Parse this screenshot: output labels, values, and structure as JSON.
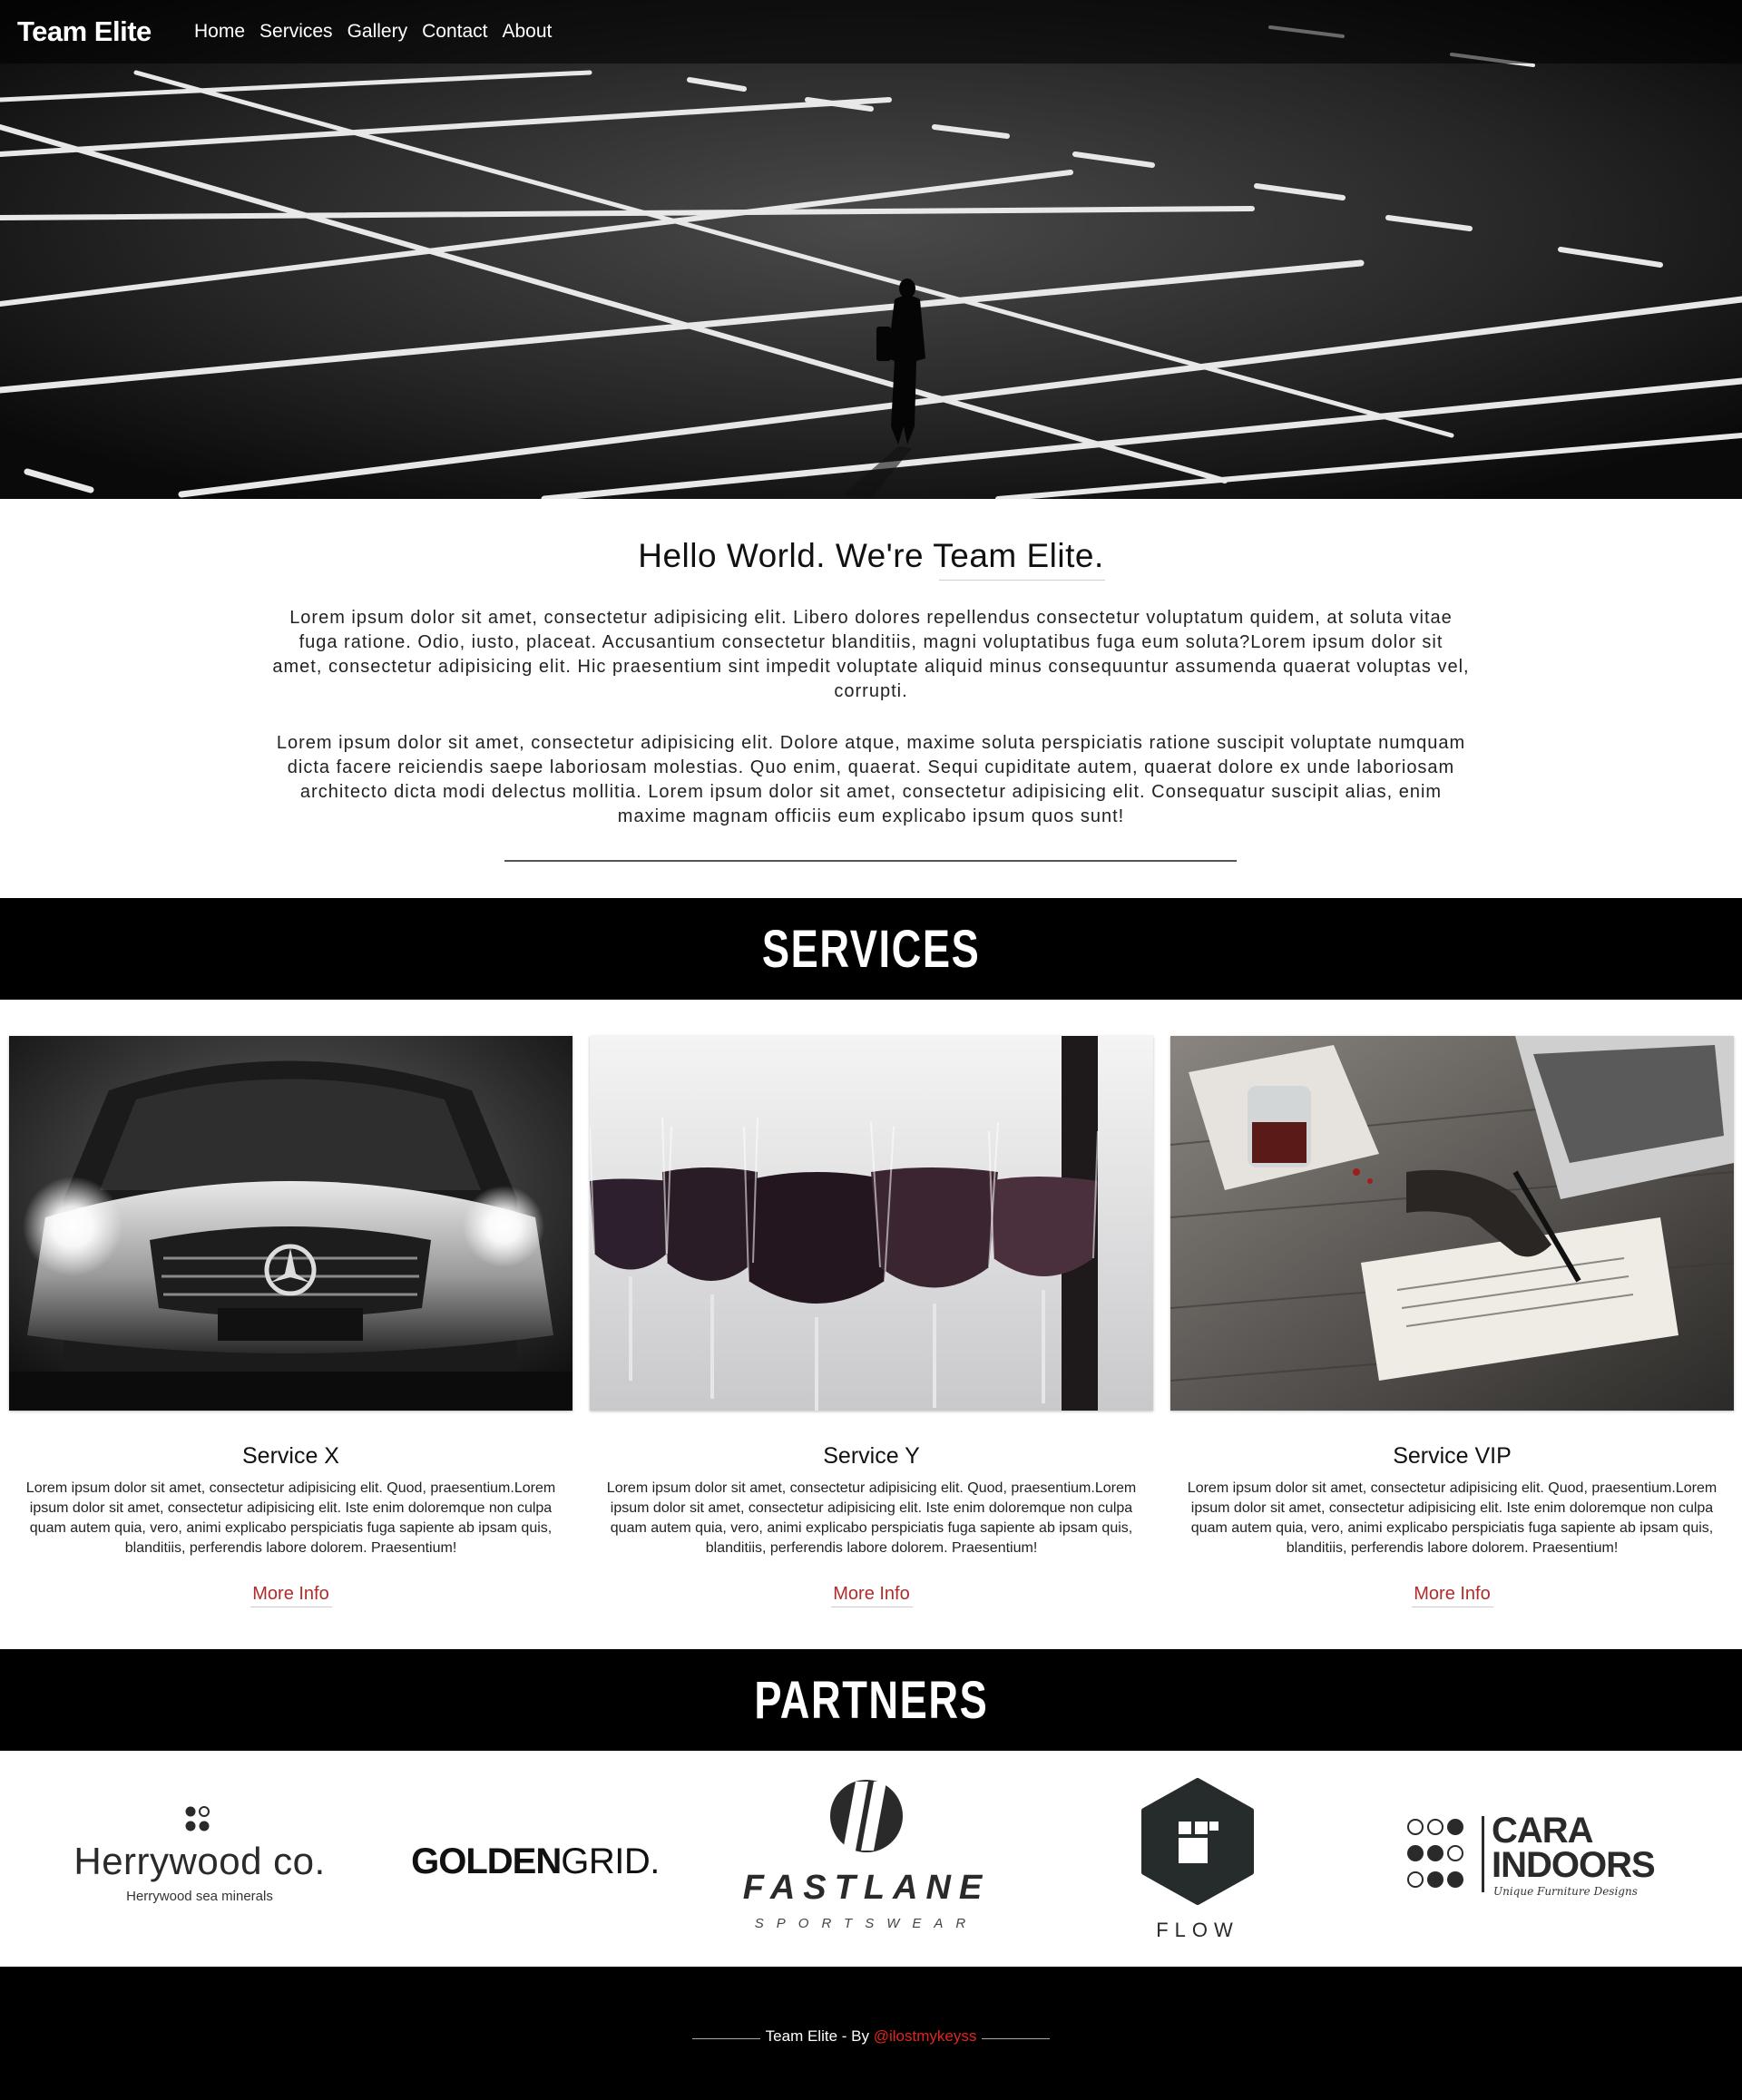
{
  "nav": {
    "brand": "Team Elite",
    "links": [
      "Home",
      "Services",
      "Gallery",
      "Contact",
      "About"
    ]
  },
  "intro": {
    "title": "Hello World. We're Team Elite.",
    "paragraph_1": "Lorem ipsum dolor sit amet, consectetur adipisicing elit. Libero dolores repellendus consectetur voluptatum quidem, at soluta vitae fuga ratione. Odio, iusto, placeat. Accusantium consectetur blanditiis, magni voluptatibus fuga eum soluta?Lorem ipsum dolor sit amet, consectetur adipisicing elit. Hic praesentium sint impedit voluptate aliquid minus consequuntur assumenda quaerat voluptas vel, corrupti.",
    "paragraph_2": "Lorem ipsum dolor sit amet, consectetur adipisicing elit. Dolore atque, maxime soluta perspiciatis ratione suscipit voluptate numquam dicta facere reiciendis saepe laboriosam molestias. Quo enim, quaerat. Sequi cupiditate autem, quaerat dolore ex unde laboriosam architecto dicta modi delectus mollitia. Lorem ipsum dolor sit amet, consectetur adipisicing elit. Consequatur suscipit alias, enim maxime magnam officiis eum explicabo ipsum quos sunt!"
  },
  "services": {
    "heading": "SERVICES",
    "cards": [
      {
        "title": "Service X",
        "text": "Lorem ipsum dolor sit amet, consectetur adipisicing elit. Quod, praesentium.Lorem ipsum dolor sit amet, consectetur adipisicing elit. Iste enim doloremque non culpa quam autem quia, vero, animi explicabo perspiciatis fuga sapiente ab ipsam quis, blanditiis, perferendis labore dolorem. Praesentium!",
        "link": "More Info"
      },
      {
        "title": "Service Y",
        "text": "Lorem ipsum dolor sit amet, consectetur adipisicing elit. Quod, praesentium.Lorem ipsum dolor sit amet, consectetur adipisicing elit. Iste enim doloremque non culpa quam autem quia, vero, animi explicabo perspiciatis fuga sapiente ab ipsam quis, blanditiis, perferendis labore dolorem. Praesentium!",
        "link": "More Info"
      },
      {
        "title": "Service VIP",
        "text": "Lorem ipsum dolor sit amet, consectetur adipisicing elit. Quod, praesentium.Lorem ipsum dolor sit amet, consectetur adipisicing elit. Iste enim doloremque non culpa quam autem quia, vero, animi explicabo perspiciatis fuga sapiente ab ipsam quis, blanditiis, perferendis labore dolorem. Praesentium!",
        "link": "More Info"
      }
    ]
  },
  "partners": {
    "heading": "PARTNERS",
    "logos": {
      "herrywood": {
        "name": "Herrywood co.",
        "tagline": "Herrywood sea minerals"
      },
      "goldengrid": {
        "bold": "GOLDEN",
        "light": "GRID."
      },
      "fastlane": {
        "name": "FASTLANE",
        "tagline": "SPORTSWEAR"
      },
      "flow": {
        "name": "FLOW"
      },
      "cara": {
        "line1": "CARA",
        "line2": "INDOORS",
        "tagline": "Unique Furniture Designs"
      }
    }
  },
  "footer": {
    "text": "Team Elite - By ",
    "handle": "@ilostmykeyss"
  },
  "colors": {
    "accent_link": "#b02a2a",
    "footer_handle": "#e0261e",
    "section_bg": "#000000"
  }
}
